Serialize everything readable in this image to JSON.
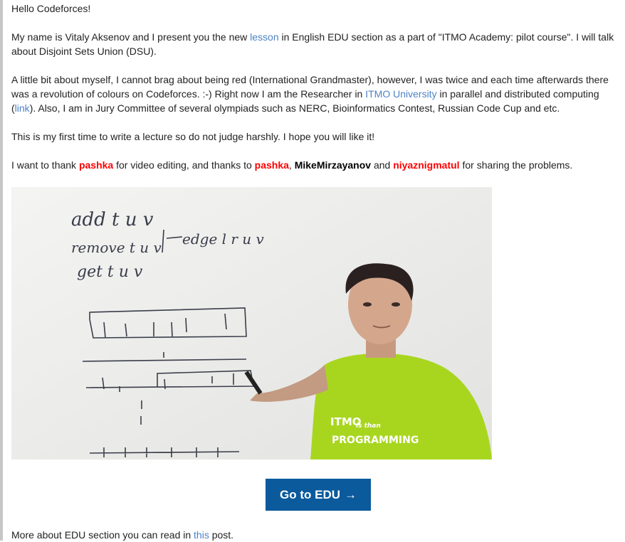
{
  "post": {
    "hello": "Hello Codeforces!",
    "intro": {
      "t1": "My name is Vitaly Aksenov and I present you the new ",
      "lesson_link": "lesson",
      "t2": " in English EDU section as a part of \"ITMO Academy: pilot course\". I will talk about Disjoint Sets Union (DSU)."
    },
    "about": {
      "t1": "A little bit about myself, I cannot brag about being red (International Grandmaster), however, I was twice and each time afterwards there was a revolution of colours on Codeforces. :-) Right now I am the Researcher in ",
      "itmo_link": "ITMO University",
      "t2": " in parallel and distributed computing (",
      "link_link": "link",
      "t3": "). Also, I am in Jury Committee of several olympiads such as NERC, Bioinformatics Contest, Russian Code Cup and etc."
    },
    "first_time": "This is my first time to write a lecture so do not judge harshly. I hope you will like it!",
    "thanks": {
      "t1": "I want to thank ",
      "user1": "pashka",
      "t2": " for video editing, and thanks to ",
      "user2": "pashka",
      "t3": ", ",
      "user3": "MikeMirzayanov",
      "t4": " and ",
      "user4": "niyaznigmatul",
      "t5": " for sharing the problems."
    },
    "video": {
      "board_lines": [
        "add t u v",
        "remove t u v",
        "get t u v",
        "edge l r u v"
      ],
      "shirt_text": [
        "ITMO",
        "is than",
        "PROGRAMMING"
      ]
    },
    "edu_button": {
      "label": "Go to EDU",
      "arrow": "→"
    },
    "more": {
      "t1": "More about EDU section you can read in ",
      "this_link": "this",
      "t2": " post."
    },
    "colors": {
      "link": "#4d83c7",
      "red_user": "#ff0000",
      "button": "#0a5a9c"
    }
  }
}
